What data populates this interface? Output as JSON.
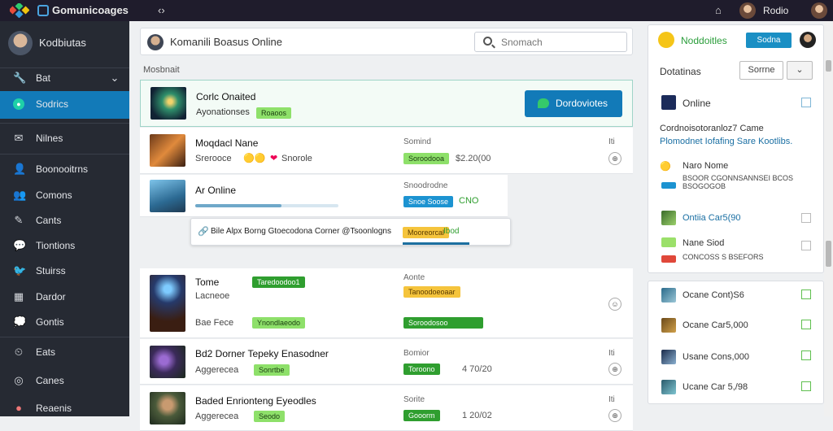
{
  "topbar": {
    "app_title": "Gomunicoages",
    "user_label": "Rodio",
    "nav_glyph": "‹›",
    "bell_glyph": "⌂"
  },
  "sidebar": {
    "profile_name": "Kodbiutas",
    "items": [
      {
        "label": "Bat",
        "icon": "wrench-icon",
        "glyph": "🔧",
        "has_chevron": true
      },
      {
        "label": "Sodrics",
        "icon": "dot-icon",
        "glyph": "●",
        "active": true
      },
      {
        "label": "Nilnes",
        "icon": "mail-icon",
        "glyph": "✉"
      },
      {
        "label": "Boonooitrns",
        "icon": "user-icon",
        "glyph": "👤"
      },
      {
        "label": "Comons",
        "icon": "users-icon",
        "glyph": "👥"
      },
      {
        "label": "Cants",
        "icon": "edit-icon",
        "glyph": "✎"
      },
      {
        "label": "Tiontions",
        "icon": "chat-icon",
        "glyph": "💬"
      },
      {
        "label": "Stuirss",
        "icon": "bird-icon",
        "glyph": "🐦"
      },
      {
        "label": "Dardor",
        "icon": "grid-icon",
        "glyph": "▦"
      },
      {
        "label": "Gontis",
        "icon": "comment-icon",
        "glyph": "💭"
      },
      {
        "label": "Eats",
        "icon": "clock-icon",
        "glyph": "⏲"
      },
      {
        "label": "Canes",
        "icon": "globe-icon",
        "glyph": "◎"
      },
      {
        "label": "Reaenis",
        "icon": "avatar-icon",
        "glyph": "●"
      }
    ],
    "chevron": "⌄"
  },
  "main": {
    "search_card_title": "Komanili Boasus Online",
    "search_placeholder": "Snomach",
    "section_label": "Mosbnait",
    "featured": {
      "title": "Corlc Onaited",
      "sub": "Ayonationses",
      "pill": "Roaoos",
      "cta_label": "Dordoviotes"
    },
    "rows": [
      {
        "title": "Moqdacl Nane",
        "sub": "Srerooce",
        "extra": "Snorole",
        "meta_label": "Somind",
        "pill": "Soroodooa",
        "pill_color": "green",
        "value": "$2.20(00",
        "side": "Iti"
      },
      {
        "title": "Ar Online",
        "meta_label": "Snoodrodne",
        "pill": "Snoe Soose",
        "pill_color": "blue",
        "value": "CNO",
        "progress": 0.6
      }
    ],
    "tooltip": {
      "text": "Bile Alpx Borng Gtoecodona Corner @Tsoonlogns",
      "pill1": "Mooreorcal",
      "pill2": "Ibod"
    },
    "rows2": [
      {
        "title": "Tome",
        "sub": "Lacneoe",
        "pill": "Taredoodoo1",
        "meta_label": "Aonte",
        "pill2": "Tanoodoeoaar",
        "pill2_color": "yellow",
        "sub2": "Bae Fece",
        "pill3": "Ynondlaeodo",
        "pill4": "Soroodosoo",
        "side": "☺"
      },
      {
        "title": "Bd2 Dorner Tepeky Enasodner",
        "sub": "Aggerecea",
        "pill": "Sonrtbe",
        "meta_label": "Bomior",
        "pill2": "Toroono",
        "value": "4 70/20",
        "side": "Iti"
      },
      {
        "title": "Baded Enrionteng Eyeodles",
        "sub": "Aggerecea",
        "pill": "Seodo",
        "meta_label": "Sorite",
        "pill2": "Gooorm",
        "value": "1 20/02",
        "side": "Iti"
      }
    ]
  },
  "right_panel": {
    "title": "Noddoitles",
    "btn_label": "Sodna",
    "filter_label": "Dotatinas",
    "select_value": "Sorrne",
    "chevron": "⌄",
    "items": [
      {
        "label": "Online"
      },
      {
        "label": "Cordnoisotoranloz7 Came",
        "sub": "Plomodnet Iofafing Sare Kootlibs."
      },
      {
        "label": "Naro Nome",
        "sub": "BSOOR CGONNSANNSEI BCOS BSOGOGOB"
      },
      {
        "label": "Ontiia Car5(90"
      },
      {
        "label": "Nane Siod",
        "sub": "CONCOSS S BSEFORS"
      }
    ],
    "items2": [
      {
        "label": "Ocane Cont)S6"
      },
      {
        "label": "Ocane Car5,000"
      },
      {
        "label": "Usane Cons,000"
      },
      {
        "label": "Ucane Car 5,/98"
      }
    ]
  },
  "colors": {
    "accent": "#127ab8",
    "sidebar": "#262a33",
    "topbar": "#1f1c2c",
    "green": "#8ee06a"
  }
}
